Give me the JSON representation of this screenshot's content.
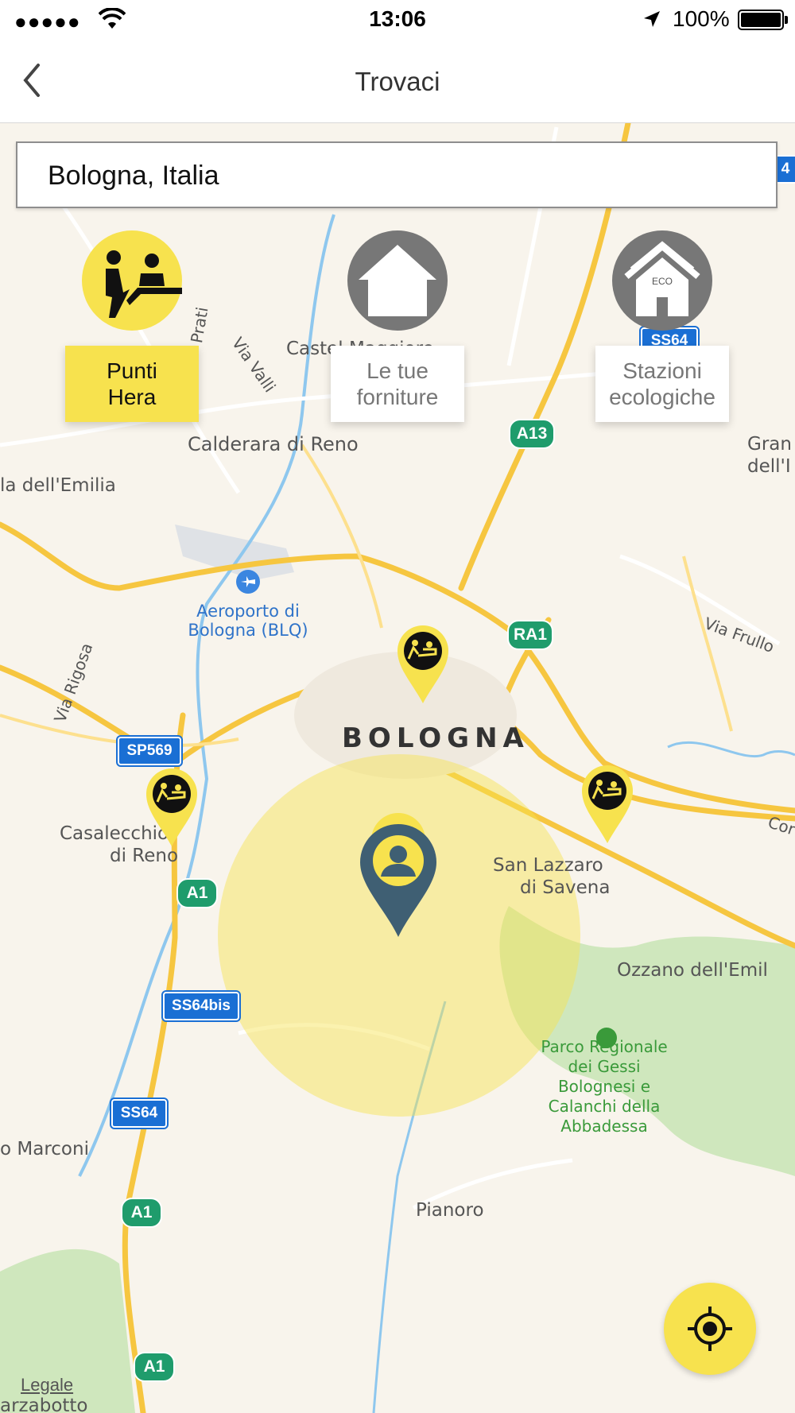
{
  "status_bar": {
    "signal": "●●●●●",
    "time": "13:06",
    "battery": "100%"
  },
  "navbar": {
    "title": "Trovaci",
    "back_icon": "chevron-left-icon"
  },
  "search": {
    "value": "Bologna, Italia"
  },
  "categories": [
    {
      "label_line1": "Punti",
      "label_line2": "Hera",
      "icon": "service-desk-icon",
      "selected": true
    },
    {
      "label_line1": "Le tue",
      "label_line2": "forniture",
      "icon": "house-icon",
      "selected": false
    },
    {
      "label_line1": "Stazioni",
      "label_line2": "ecologiche",
      "icon": "eco-house-icon",
      "selected": false,
      "badge": "ECO"
    }
  ],
  "map": {
    "city": "BOLOGNA",
    "places": [
      "Castel Maggiore",
      "Calderara di Reno",
      "la dell'Emilia",
      "Aeroporto di",
      "Bologna (BLQ)",
      "Via Valli",
      "Prati",
      "Via Rigosa",
      "Casalecchio",
      "di Reno",
      "San Lazzaro",
      "di Savena",
      "Ozzano dell'Emil",
      "Parco Regionale",
      "dei Gessi",
      "Bolognesi e",
      "Calanchi della",
      "Abbadessa",
      "Pianoro",
      "o Marconi",
      "Via Frullo",
      "Gran",
      "dell'I",
      "Cor",
      "arzabotto"
    ],
    "road_shields": [
      "SS64",
      "A13",
      "RA1",
      "SP569",
      "A1",
      "SS64bis",
      "SS64",
      "A1",
      "A1",
      "4"
    ],
    "legal": "Legale"
  },
  "colors": {
    "accent": "#f7e24e",
    "pin_dark": "#3f5f73",
    "grey_button": "#777777",
    "shield_blue": "#1a6fd4",
    "shield_green": "#1f9c6c"
  }
}
